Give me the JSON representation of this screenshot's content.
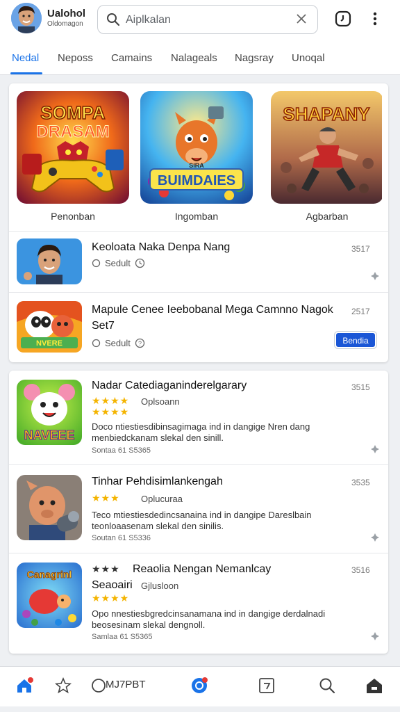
{
  "header": {
    "user_name": "Ualohol",
    "user_sub": "Oldomagon",
    "search_placeholder": "Aiplkalan"
  },
  "tabs": [
    "Nedal",
    "Neposs",
    "Camains",
    "Nalageals",
    "Nagsray",
    "Unoqal"
  ],
  "featured": {
    "tiles": [
      {
        "title_line1": "SOMPA",
        "title_line2": "DRASAM",
        "label": "Penonban"
      },
      {
        "title_line1": "SIRA",
        "title_line2": "BUIMDAIES",
        "label": "Ingomban"
      },
      {
        "title_line1": "SHAPANY",
        "title_line2": "",
        "label": "Agbarban"
      }
    ],
    "rows": [
      {
        "title": "Keoloata Naka Denpa Nang",
        "meta": "Sedult",
        "num": "3517"
      },
      {
        "title": "Mapule Cenee Ieebobanal Mega Camnno Nagok",
        "title2": "Set7",
        "meta": "Sedult",
        "num": "2517",
        "button": "Bendia"
      }
    ]
  },
  "list": [
    {
      "title": "Nadar Catediaganinderelgarary",
      "stars": "★★★★",
      "stars2": "★★★★",
      "sub": "Oplsoann",
      "desc1": "Doco ntiestiesdibinsagimaga ind in dangige Nren dang",
      "desc2": "menbiedckanam slekal den sinill.",
      "small": "Sontaa 61 S5365",
      "num": "3515",
      "tile_word": "NAVEEE"
    },
    {
      "title": "Tinhar Pehdisimlankengah",
      "stars": "★★★",
      "sub": "Oplucuraa",
      "desc1": "Teco mtiestiesdedincsanaina ind in dangipe Dareslbain",
      "desc2": "teonloaasenam slekal den sinilis.",
      "small": "Soutan 61 S5336",
      "num": "3535"
    },
    {
      "title": "Reaolia Nengan Nemanlcay",
      "title_prefix": "★★★",
      "title2": "Seaoairi",
      "stars": "★★★★",
      "sub": "Gjlusloon",
      "desc1": "Opo nnestiesbgredcinsanamana ind in dangige derdalnadi",
      "desc2": "beosesinam slekal dengnoll.",
      "small": "Samlaa 61 S5365",
      "num": "3516",
      "tile_word": "Canagrinl"
    }
  ],
  "bottom_nav": {
    "label": "MJ7PBT"
  },
  "colors": {
    "accent": "#1a73e8",
    "star": "#f4b400",
    "button": "#1a56d6"
  }
}
